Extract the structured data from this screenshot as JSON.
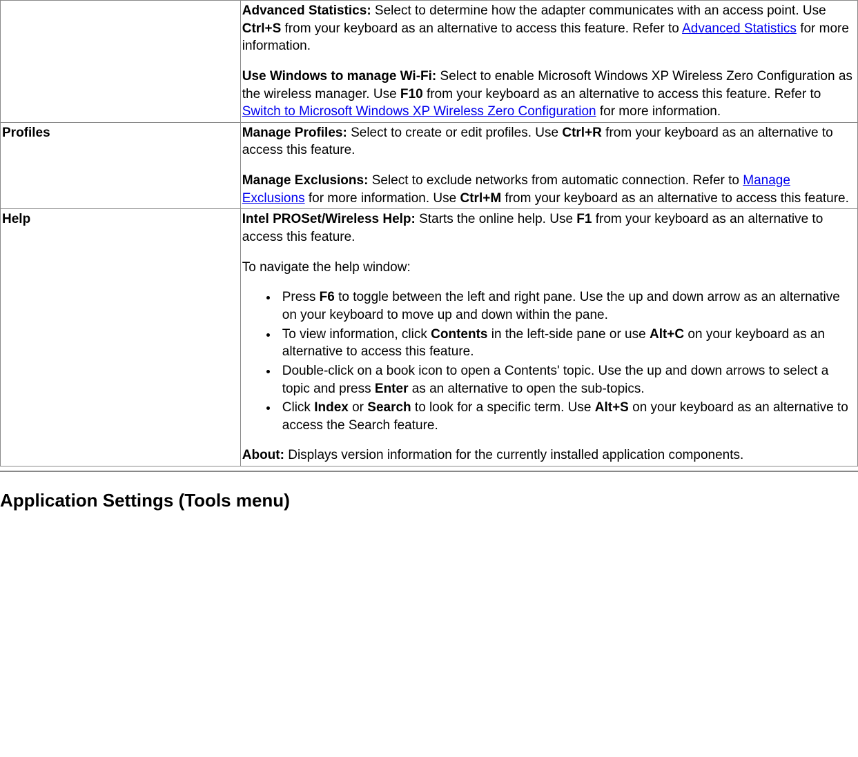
{
  "row0": {
    "p1_b": "Advanced Statistics:",
    "p1_a": " Select to determine how the adapter communicates with an access point. Use ",
    "p1_k": "Ctrl+S",
    "p1_c": " from your keyboard as an alternative to access this feature. Refer to ",
    "p1_link": "Advanced Statistics",
    "p1_d": " for more information.",
    "p2_b": "Use Windows to manage Wi-Fi:",
    "p2_a": " Select to enable Microsoft Windows XP Wireless Zero Configuration as the wireless manager. Use ",
    "p2_k": "F10",
    "p2_c": " from your keyboard as an alternative to access this feature. Refer to ",
    "p2_link": "Switch to Microsoft Windows XP Wireless Zero Configuration",
    "p2_d": " for more information."
  },
  "row1": {
    "left": "Profiles",
    "p1_b": "Manage Profiles:",
    "p1_a": " Select to create or edit profiles. Use ",
    "p1_k": "Ctrl+R",
    "p1_c": " from your keyboard as an alternative to access this feature.",
    "p2_b": "Manage Exclusions:",
    "p2_a": " Select to exclude networks from automatic connection. Refer to ",
    "p2_link": "Manage Exclusions",
    "p2_c": " for more information. Use ",
    "p2_k": "Ctrl+M",
    "p2_d": " from your keyboard as an alternative to access this feature."
  },
  "row2": {
    "left": "Help",
    "p1_b": "Intel PROSet/Wireless Help:",
    "p1_a": " Starts the online help. Use ",
    "p1_k": "F1",
    "p1_c": " from your keyboard as an alternative to access this feature.",
    "p2": "To navigate the help window:",
    "li1_a": "Press ",
    "li1_k": "F6",
    "li1_b": " to toggle between the left and right pane. Use the up and down arrow as an alternative on your keyboard to move up and down within the pane.",
    "li2_a": "To view information, click ",
    "li2_k1": "Contents",
    "li2_b": " in the left-side pane or use ",
    "li2_k2": "Alt+C",
    "li2_c": " on your keyboard as an alternative to access this feature.",
    "li3_a": "Double-click on a book icon to open a Contents' topic. Use the up and down arrows to select a topic and press ",
    "li3_k": "Enter",
    "li3_b": " as an alternative to open the sub-topics.",
    "li4_a": "Click ",
    "li4_k1": "Index",
    "li4_b": " or ",
    "li4_k2": "Search",
    "li4_c": " to look for a specific term. Use ",
    "li4_k3": "Alt+S",
    "li4_d": " on your keyboard as an alternative to access the Search feature.",
    "p3_b": "About:",
    "p3_a": " Displays version information for the currently installed application components."
  },
  "heading": "Application Settings (Tools menu)"
}
